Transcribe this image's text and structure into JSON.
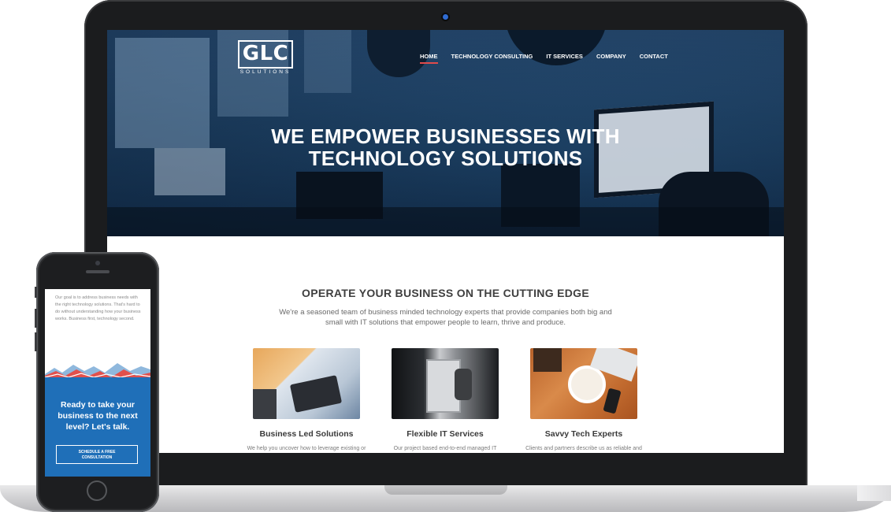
{
  "site": {
    "logo_text": "GLC",
    "logo_sub": "SOLUTIONS",
    "nav": [
      "HOME",
      "TECHNOLOGY CONSULTING",
      "IT SERVICES",
      "COMPANY",
      "CONTACT"
    ],
    "nav_active": "HOME",
    "hero_title_line1": "WE EMPOWER BUSINESSES WITH",
    "hero_title_line2": "TECHNOLOGY SOLUTIONS",
    "section_title": "OPERATE YOUR BUSINESS ON THE CUTTING EDGE",
    "section_desc_line1": "We're a seasoned team of business minded technology experts that provide companies both big and",
    "section_desc_line2": "small with IT solutions that empower people to learn, thrive and produce.",
    "cards": [
      {
        "title": "Business Led Solutions",
        "text": "We help you uncover how to leverage existing or"
      },
      {
        "title": "Flexible IT Services",
        "text": "Our project based end-to-end managed IT"
      },
      {
        "title": "Savvy Tech Experts",
        "text": "Clients and partners describe us as reliable and"
      }
    ],
    "accent_color": "#e04b4b"
  },
  "phone": {
    "intro_text": "Our goal is to address business needs with the right technology solutions. That's hard to do without understanding how your business works. Business first, technology second.",
    "cta_line1": "Ready to take your",
    "cta_line2": "business to the next",
    "cta_line3": "level? Let's talk.",
    "button_line1": "SCHEDULE A FREE",
    "button_line2": "CONSULTATION",
    "cta_bg": "#1f6fb8"
  }
}
